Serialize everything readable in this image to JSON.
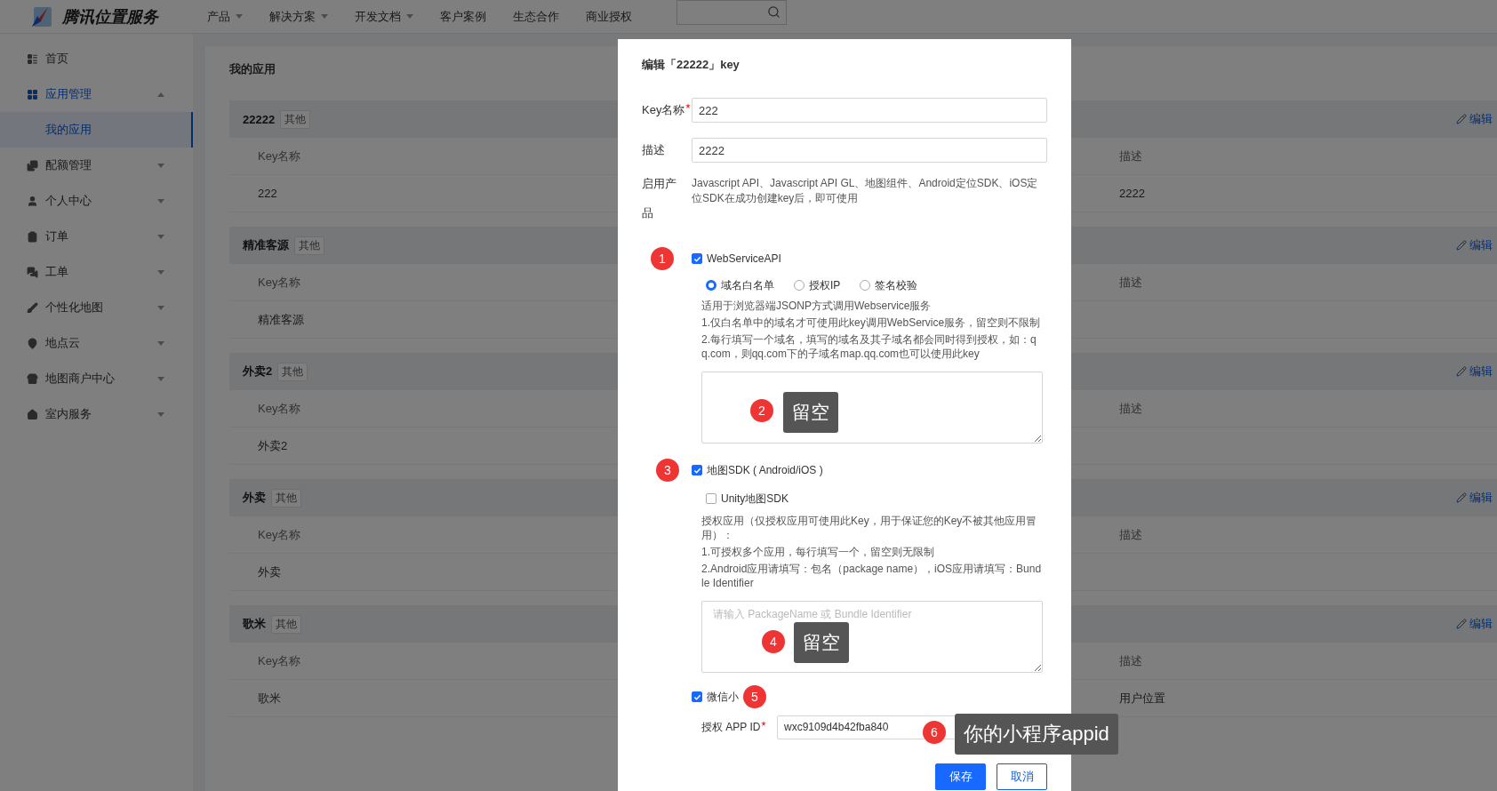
{
  "header": {
    "logo": "腾讯位置服务",
    "nav": [
      {
        "label": "产品",
        "has_menu": true
      },
      {
        "label": "解决方案",
        "has_menu": true
      },
      {
        "label": "开发文档",
        "has_menu": true
      },
      {
        "label": "客户案例",
        "has_menu": false
      },
      {
        "label": "生态合作",
        "has_menu": false
      },
      {
        "label": "商业授权",
        "has_menu": false
      }
    ]
  },
  "sidebar": {
    "items": [
      {
        "label": "首页",
        "selected": false
      },
      {
        "label": "应用管理",
        "selected": false,
        "expanded": true,
        "children": [
          {
            "label": "我的应用",
            "selected": true
          }
        ]
      },
      {
        "label": "配额管理",
        "selected": false,
        "expanded": false
      },
      {
        "label": "个人中心",
        "selected": false,
        "expanded": false
      },
      {
        "label": "订单",
        "selected": false,
        "expanded": false
      },
      {
        "label": "工单",
        "selected": false,
        "expanded": false
      },
      {
        "label": "个性化地图",
        "selected": false,
        "expanded": false
      },
      {
        "label": "地点云",
        "selected": false,
        "expanded": false
      },
      {
        "label": "地图商户中心",
        "selected": false,
        "expanded": false
      },
      {
        "label": "室内服务",
        "selected": false,
        "expanded": false
      }
    ]
  },
  "page_title": "我的应用",
  "apps": [
    {
      "name": "22222",
      "tag": "其他",
      "edit": "编辑",
      "columns": [
        "Key名称",
        "描述"
      ],
      "row": {
        "key_name": "222",
        "description": "2222"
      }
    },
    {
      "name": "精准客源",
      "tag": "其他",
      "edit": "编辑",
      "columns": [
        "Key名称",
        "描述"
      ],
      "row": {
        "key_name": "精准客源"
      }
    },
    {
      "name": "外卖2",
      "tag": "其他",
      "edit": "编辑",
      "columns": [
        "Key名称",
        "描述"
      ],
      "row": {
        "key_name": "外卖2"
      }
    },
    {
      "name": "外卖",
      "tag": "其他",
      "edit": "编辑",
      "columns": [
        "Key名称",
        "描述"
      ],
      "row": {
        "key_name": "外卖"
      }
    },
    {
      "name": "歌米",
      "tag": "其他",
      "edit": "编辑",
      "columns": [
        "Key名称",
        "描述"
      ],
      "row": {
        "key_name": "歌米",
        "description": "用户位置"
      }
    }
  ],
  "dialog": {
    "title": "编辑「22222」key",
    "fields": [
      {
        "label": "Key名称",
        "required": true,
        "value": "222"
      },
      {
        "label": "描述",
        "required": false,
        "value": "2222"
      }
    ],
    "products_label": "启用产品",
    "products_text": "Javascript API、Javascript API GL、地图组件、Android定位SDK、iOS定位SDK在成功创建key后，即可使用",
    "sections": [
      {
        "kind": "radio-group",
        "label": "WebServiceAPI",
        "checked": true,
        "badge": "1",
        "options": [
          {
            "label": "域名白名单",
            "selected": true
          },
          {
            "label": "授权IP",
            "selected": false
          },
          {
            "label": "签名校验",
            "selected": false
          }
        ],
        "help": [
          "适用于浏览器端JSONP方式调用Webservice服务",
          "1.仅白名单中的域名才可使用此key调用WebService服务，留空则不限制",
          "2.每行填写一个域名，填写的域名及其子域名都会同时得到授权，如：qq.com，则qq.com下的子域名map.qq.com也可以使用此key"
        ],
        "textarea": {
          "annotation": {
            "badge": "2",
            "note": "留空"
          }
        }
      },
      {
        "kind": "sub-option",
        "label": "地图SDK ( Android/iOS )",
        "checked": true,
        "badge": "3",
        "sub_option": {
          "label": "Unity地图SDK",
          "checked": false
        },
        "help": [
          "授权应用（仅授权应用可使用此Key，用于保证您的Key不被其他应用冒用）：",
          "1.可授权多个应用，每行填写一个，留空则无限制",
          "2.Android应用请填写：包名（package name），iOS应用请填写：Bundle Identifier"
        ],
        "textarea": {
          "placeholder": "请输入 PackageName 或 Bundle Identifier",
          "annotation": {
            "badge": "4",
            "note": "留空"
          }
        }
      },
      {
        "kind": "app-id",
        "label": "微信小",
        "checked": true,
        "badge": "5",
        "field": {
          "label": "授权 APP ID",
          "required": true,
          "value": "wxc9109d4b42fba840",
          "annotation": {
            "badge": "6",
            "note": "你的小程序appid"
          }
        }
      }
    ],
    "buttons": [
      {
        "label": "保存",
        "primary": true
      },
      {
        "label": "取消",
        "primary": false
      }
    ]
  }
}
